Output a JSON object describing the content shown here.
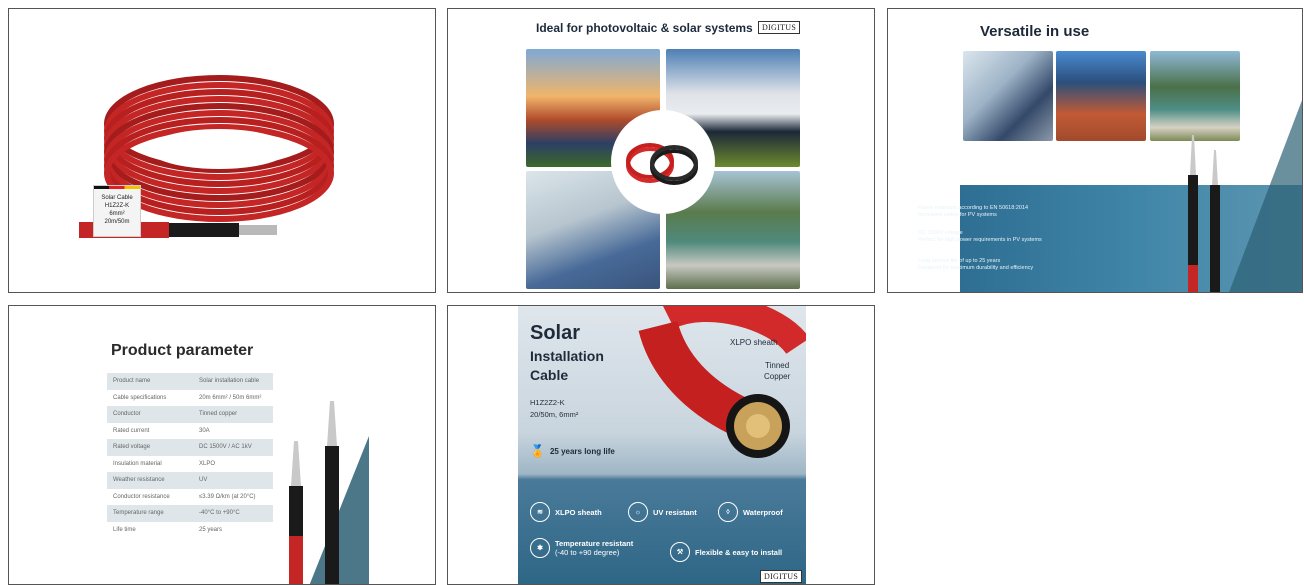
{
  "tile1": {
    "label_lines": [
      "Solar Cable",
      "H1Z2Z-K",
      "6mm²",
      "20m/50m"
    ]
  },
  "tile2": {
    "title": "Ideal for photovoltaic & solar systems",
    "brand": "DIGITUS"
  },
  "tile3": {
    "title": "Versatile in use",
    "features": [
      {
        "line1": "Flame retardant according to EN 50618:2014",
        "line2": "Increased safety for PV systems"
      },
      {
        "line1": "DC 1500V voltage",
        "line2": "Perfect for high power requirements in PV systems"
      },
      {
        "line1": "Long service life of up to 25 years",
        "line2": "Designed for maximum durability and efficiency"
      }
    ]
  },
  "tile4": {
    "title": "Product parameter",
    "rows": [
      {
        "k": "Product name",
        "v": "Solar installation cable"
      },
      {
        "k": "Cable specifications",
        "v": "20m 6mm² / 50m 6mm²"
      },
      {
        "k": "Conductor",
        "v": "Tinned copper"
      },
      {
        "k": "Rated current",
        "v": "30A"
      },
      {
        "k": "Rated voltage",
        "v": "DC 1500V / AC 1kV"
      },
      {
        "k": "Insulation material",
        "v": "XLPO"
      },
      {
        "k": "Weather resistance",
        "v": "UV"
      },
      {
        "k": "Conductor resistance",
        "v": "≤3.39 Ω/km (at 20°C)"
      },
      {
        "k": "Temperature range",
        "v": "-40°C to +90°C"
      },
      {
        "k": "Life time",
        "v": "25 years"
      }
    ]
  },
  "tile5": {
    "title1": "Solar",
    "title2": "Installation",
    "title3": "Cable",
    "model": "H1Z2Z2-K",
    "sizes": "20/50m, 6mm²",
    "sheath_label": "XLPO sheath",
    "copper_label1": "Tinned",
    "copper_label2": "Copper",
    "life": "25 years long life",
    "badges": {
      "xlpo": "XLPO sheath",
      "uv": "UV resistant",
      "water": "Waterproof",
      "temp1": "Temperature resistant",
      "temp2": "(-40 to +90 degree)",
      "flex": "Flexible & easy to install"
    },
    "brand": "DIGITUS"
  }
}
